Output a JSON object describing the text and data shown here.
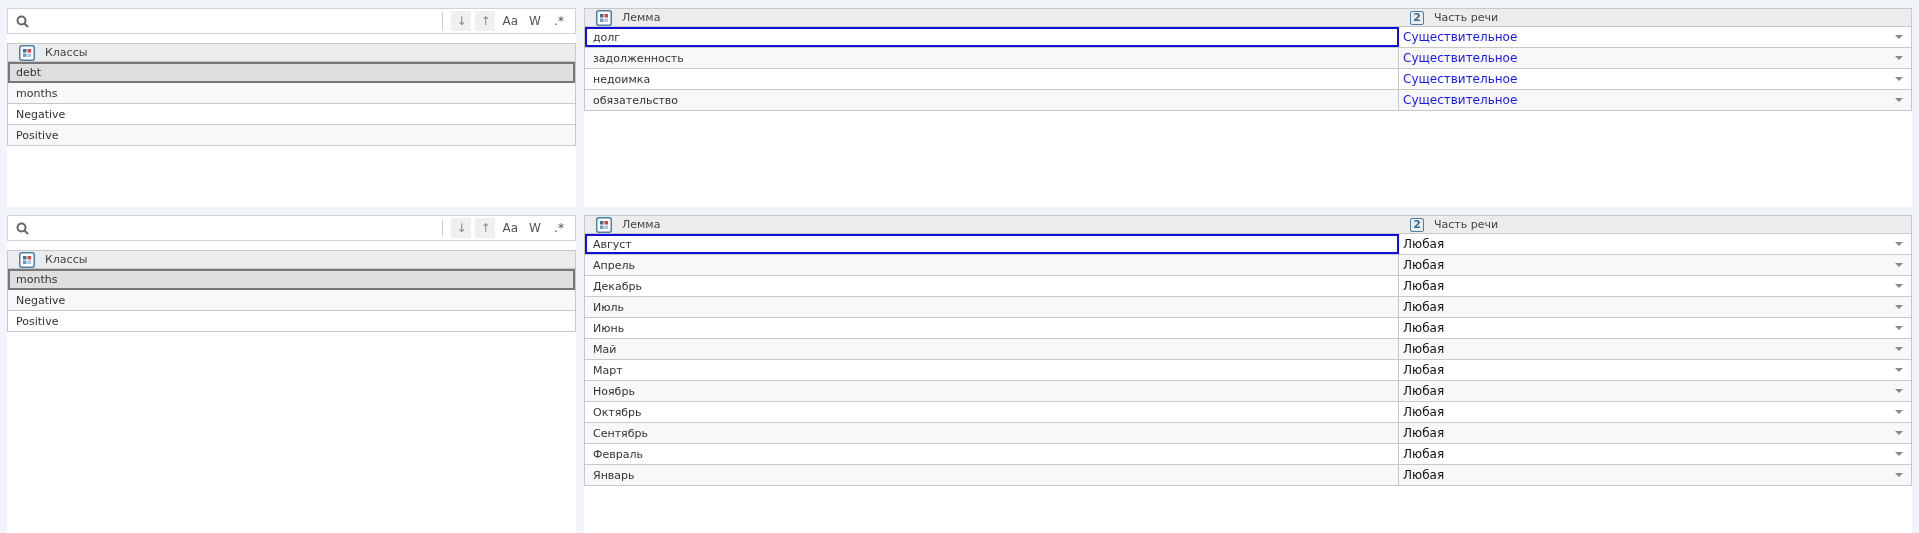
{
  "sections": [
    {
      "search": {
        "buttons": [
          {
            "label": "↓",
            "disabled": true
          },
          {
            "label": "↑",
            "disabled": true
          },
          {
            "label": "Aa",
            "disabled": false
          },
          {
            "label": "W",
            "disabled": false
          },
          {
            "label": ".*",
            "disabled": false
          }
        ]
      },
      "classes": {
        "header": "Классы",
        "items": [
          {
            "label": "debt",
            "selected": true
          },
          {
            "label": "months",
            "selected": false
          },
          {
            "label": "Negative",
            "selected": false
          },
          {
            "label": "Positive",
            "selected": false
          }
        ]
      },
      "lemmas": {
        "columns": [
          {
            "label": "Лемма"
          },
          {
            "label": "Часть речи",
            "badge": "2"
          }
        ],
        "rows": [
          {
            "lemma": "долг",
            "pos": "Существительное",
            "focused": true,
            "changed": true
          },
          {
            "lemma": "задолженность",
            "pos": "Существительное",
            "focused": false,
            "changed": true
          },
          {
            "lemma": "недоимка",
            "pos": "Существительное",
            "focused": false,
            "changed": true
          },
          {
            "lemma": "обязательство",
            "pos": "Существительное",
            "focused": false,
            "changed": true
          }
        ]
      }
    },
    {
      "search": {
        "buttons": [
          {
            "label": "↓",
            "disabled": true
          },
          {
            "label": "↑",
            "disabled": true
          },
          {
            "label": "Aa",
            "disabled": false
          },
          {
            "label": "W",
            "disabled": false
          },
          {
            "label": ".*",
            "disabled": false
          }
        ]
      },
      "classes": {
        "header": "Классы",
        "items": [
          {
            "label": "months",
            "selected": true
          },
          {
            "label": "Negative",
            "selected": false
          },
          {
            "label": "Positive",
            "selected": false
          }
        ]
      },
      "lemmas": {
        "columns": [
          {
            "label": "Лемма"
          },
          {
            "label": "Часть речи",
            "badge": "2"
          }
        ],
        "rows": [
          {
            "lemma": "Август",
            "pos": "Любая",
            "focused": true,
            "changed": false
          },
          {
            "lemma": "Апрель",
            "pos": "Любая",
            "focused": false,
            "changed": false
          },
          {
            "lemma": "Декабрь",
            "pos": "Любая",
            "focused": false,
            "changed": false
          },
          {
            "lemma": "Июль",
            "pos": "Любая",
            "focused": false,
            "changed": false
          },
          {
            "lemma": "Июнь",
            "pos": "Любая",
            "focused": false,
            "changed": false
          },
          {
            "lemma": "Май",
            "pos": "Любая",
            "focused": false,
            "changed": false
          },
          {
            "lemma": "Март",
            "pos": "Любая",
            "focused": false,
            "changed": false
          },
          {
            "lemma": "Ноябрь",
            "pos": "Любая",
            "focused": false,
            "changed": false
          },
          {
            "lemma": "Октябрь",
            "pos": "Любая",
            "focused": false,
            "changed": false
          },
          {
            "lemma": "Сентябрь",
            "pos": "Любая",
            "focused": false,
            "changed": false
          },
          {
            "lemma": "Февраль",
            "pos": "Любая",
            "focused": false,
            "changed": false
          },
          {
            "lemma": "Январь",
            "pos": "Любая",
            "focused": false,
            "changed": false
          }
        ]
      }
    }
  ]
}
